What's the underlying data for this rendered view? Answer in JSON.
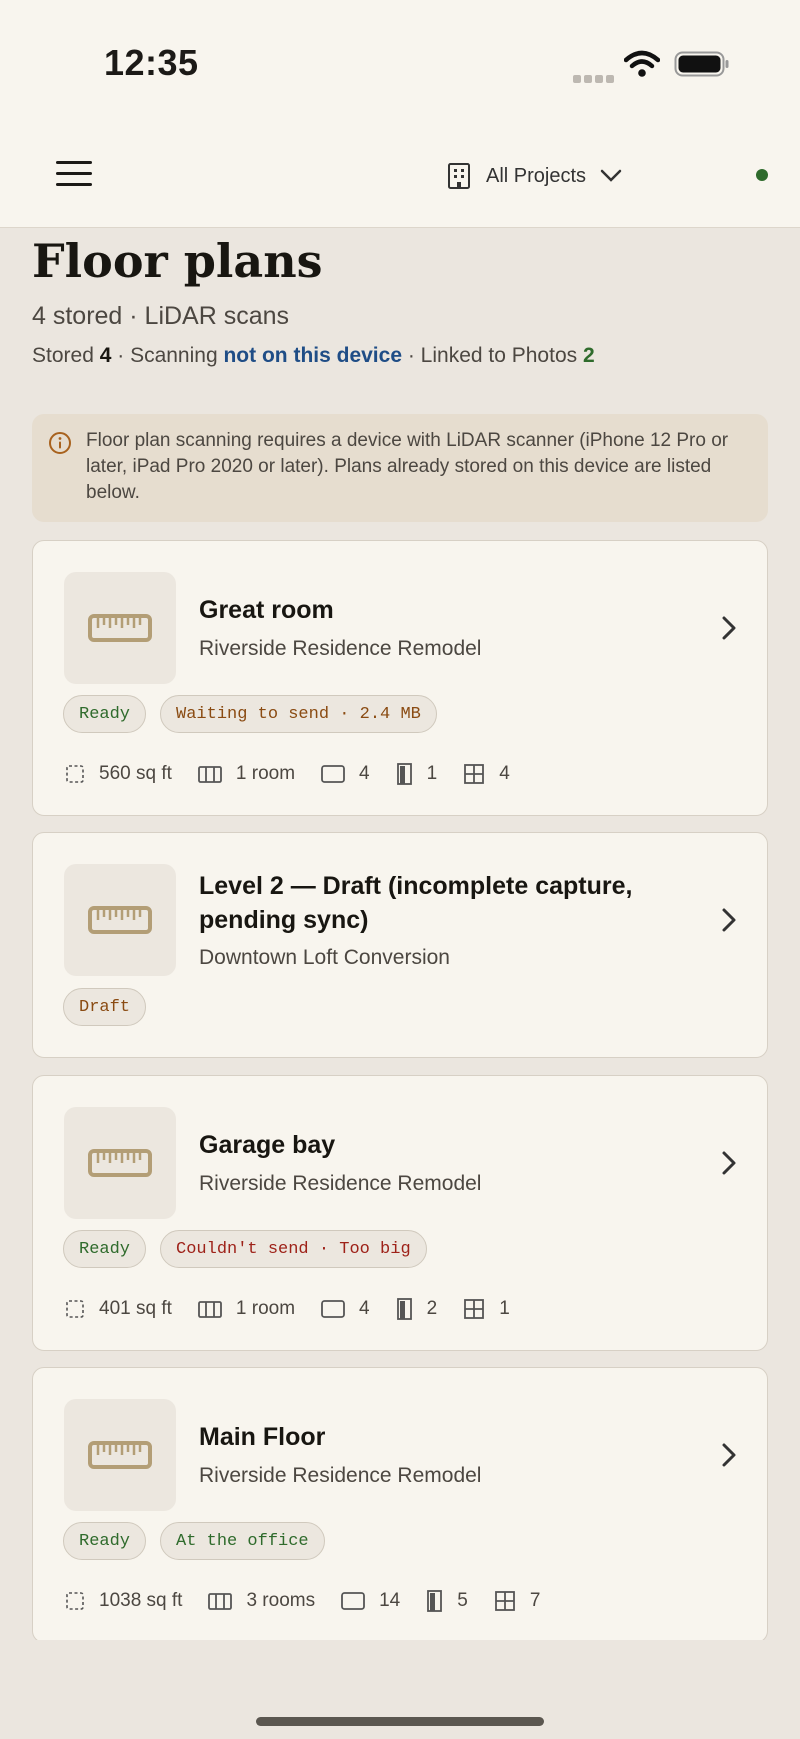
{
  "status_bar": {
    "time": "12:35"
  },
  "header": {
    "project_selector": "All Projects"
  },
  "page": {
    "title": "Floor plans",
    "subtitle": "4 stored · LiDAR scans",
    "stats": {
      "stored_label": "Stored ",
      "stored_value": "4",
      "sep1": " · Scanning ",
      "scanning_value": "not on this device",
      "sep2": " · Linked to Photos ",
      "linked_value": "2"
    }
  },
  "notice": {
    "text": "Floor plan scanning requires a device with LiDAR scanner (iPhone 12 Pro or later, iPad Pro 2020 or later). Plans already stored on this device are listed below."
  },
  "plans": [
    {
      "title": "Great room",
      "project": "Riverside Residence Remodel",
      "status": "Ready",
      "sync": "Waiting to send · 2.4 MB",
      "area": "560 sq ft",
      "rooms": "1 room",
      "walls": "4",
      "doors": "1",
      "windows": "4"
    },
    {
      "title": "Level 2 — Draft (incomplete capture, pending sync)",
      "project": "Downtown Loft Conversion",
      "status": "Draft"
    },
    {
      "title": "Garage bay",
      "project": "Riverside Residence Remodel",
      "status": "Ready",
      "sync": "Couldn't send · Too big",
      "area": "401 sq ft",
      "rooms": "1 room",
      "walls": "4",
      "doors": "2",
      "windows": "1"
    },
    {
      "title": "Main Floor",
      "project": "Riverside Residence Remodel",
      "status": "Ready",
      "sync": "At the office",
      "area": "1038 sq ft",
      "rooms": "3 rooms",
      "walls": "14",
      "doors": "5",
      "windows": "7"
    }
  ],
  "icons": {
    "menu": "hamburger-menu-icon",
    "project": "building-icon",
    "dropdown": "chevron-down-icon",
    "info": "info-icon",
    "plan_thumbnail": "ruler-icon",
    "open": "chevron-right-icon",
    "area": "dashed-square-icon",
    "rooms": "room-icon",
    "walls": "wall-icon",
    "doors": "door-icon",
    "windows": "window-icon"
  },
  "colors": {
    "background": "#ebe6df",
    "card": "#f8f5ee",
    "link_blue": "#1f4d86",
    "ok_green": "#2f6b2c",
    "warn_amber": "#8a4b12",
    "error_red": "#9e2219",
    "ruler_tan": "#b39e76"
  }
}
